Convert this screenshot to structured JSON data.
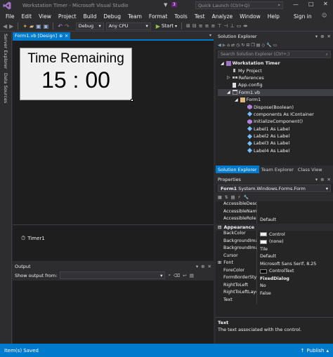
{
  "window": {
    "title": "Workstation Timer - Microsoft Visual Studio",
    "notification_count": "3",
    "quick_launch_placeholder": "Quick Launch (Ctrl+Q)",
    "sign_in": "Sign in"
  },
  "menu": [
    "File",
    "Edit",
    "View",
    "Project",
    "Build",
    "Debug",
    "Team",
    "Format",
    "Tools",
    "Test",
    "Analyze",
    "Window",
    "Help"
  ],
  "toolbar": {
    "configuration": "Debug",
    "platform": "Any CPU",
    "start_label": "Start"
  },
  "side_tabs": [
    "Server Explorer",
    "Data Sources"
  ],
  "document": {
    "tab_label": "Form1.vb [Design]",
    "form_title_label": "Time Remaining",
    "form_time_label": "15 : 00",
    "tray_component": "Timer1"
  },
  "output": {
    "title": "Output",
    "show_output_from": "Show output from:"
  },
  "solution_explorer": {
    "title": "Solution Explorer",
    "search_placeholder": "Search Solution Explorer (Ctrl+;)",
    "items": [
      {
        "label": "Workstation Timer",
        "bold": true
      },
      {
        "label": "My Project"
      },
      {
        "label": "References"
      },
      {
        "label": "App.config"
      },
      {
        "label": "Form1.vb",
        "selected": true
      },
      {
        "label": "Form1"
      },
      {
        "label": "Dispose(Boolean)"
      },
      {
        "label": "components As IContainer"
      },
      {
        "label": "InitializeComponent()"
      },
      {
        "label": "Label1 As Label"
      },
      {
        "label": "Label2 As Label"
      },
      {
        "label": "Label3 As Label"
      },
      {
        "label": "Label4 As Label"
      }
    ],
    "tabs": [
      "Solution Explorer",
      "Team Explorer",
      "Class View"
    ]
  },
  "properties": {
    "title": "Properties",
    "object": "Form1",
    "object_type": "System.Windows.Forms.Form",
    "rows": [
      {
        "name": "AccessibleDescrip",
        "value": ""
      },
      {
        "name": "AccessibleName",
        "value": ""
      },
      {
        "name": "AccessibleRole",
        "value": "Default"
      }
    ],
    "category": "Appearance",
    "appearance_rows": [
      {
        "name": "BackColor",
        "value": "Control",
        "swatch": "#f0f0f0"
      },
      {
        "name": "BackgroundImage",
        "value": "(none)",
        "swatch": "#ffffff"
      },
      {
        "name": "BackgroundImage",
        "value": "Tile"
      },
      {
        "name": "Cursor",
        "value": "Default"
      },
      {
        "name": "Font",
        "value": "Microsoft Sans Serif, 8.25"
      },
      {
        "name": "ForeColor",
        "value": "ControlText",
        "swatch": "#000000"
      },
      {
        "name": "FormBorderStyle",
        "value": "FixedDialog",
        "bold": true
      },
      {
        "name": "RightToLeft",
        "value": "No"
      },
      {
        "name": "RightToLeftLayou",
        "value": "False"
      },
      {
        "name": "Text",
        "value": ""
      }
    ],
    "desc_title": "Text",
    "desc_text": "The text associated with the control."
  },
  "status": {
    "left": "Item(s) Saved",
    "right": "Publish"
  },
  "colors": {
    "accent": "#007acc",
    "background": "#2d2d30",
    "editor": "#1e1e1e"
  }
}
